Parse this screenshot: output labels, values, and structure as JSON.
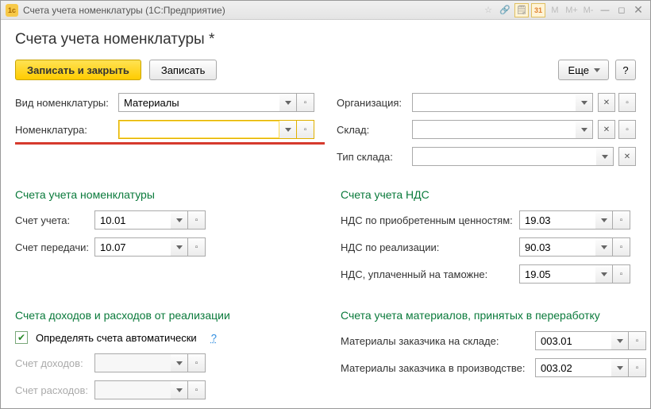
{
  "window": {
    "title": "Счета учета номенклатуры  (1С:Предприятие)",
    "pageTitle": "Счета учета номенклатуры *"
  },
  "toolbar": {
    "save_close": "Записать и закрыть",
    "save": "Записать",
    "more": "Еще",
    "help": "?"
  },
  "top": {
    "vidNomLabel": "Вид номенклатуры:",
    "vidNomValue": "Материалы",
    "orgLabel": "Организация:",
    "orgValue": "",
    "nomLabel": "Номенклатура:",
    "nomValue": "",
    "skladLabel": "Склад:",
    "skladValue": "",
    "tipSkladaLabel": "Тип склада:",
    "tipSkladaValue": ""
  },
  "sections": {
    "accounts": "Счета учета номенклатуры",
    "vat": "Счета учета НДС",
    "income": "Счета доходов и расходов от реализации",
    "materials": "Счета учета материалов, принятых в переработку"
  },
  "accounts": {
    "schetUchetaLabel": "Счет учета:",
    "schetUchetaValue": "10.01",
    "schetPeredLabel": "Счет передачи:",
    "schetPeredValue": "10.07"
  },
  "vat": {
    "ndsPriobLabel": "НДС по приобретенным ценностям:",
    "ndsPriobValue": "19.03",
    "ndsRealLabel": "НДС по реализации:",
    "ndsRealValue": "90.03",
    "ndsTamLabel": "НДС, уплаченный на таможне:",
    "ndsTamValue": "19.05"
  },
  "income": {
    "autoLabel": "Определять счета автоматически",
    "dohodLabel": "Счет доходов:",
    "dohodValue": "",
    "rashodLabel": "Счет расходов:",
    "rashodValue": ""
  },
  "materials": {
    "matSkladLabel": "Материалы заказчика на складе:",
    "matSkladValue": "003.01",
    "matProizvLabel": "Материалы заказчика в производстве:",
    "matProizvValue": "003.02"
  },
  "tbButtons": [
    "M",
    "M+",
    "M-"
  ]
}
